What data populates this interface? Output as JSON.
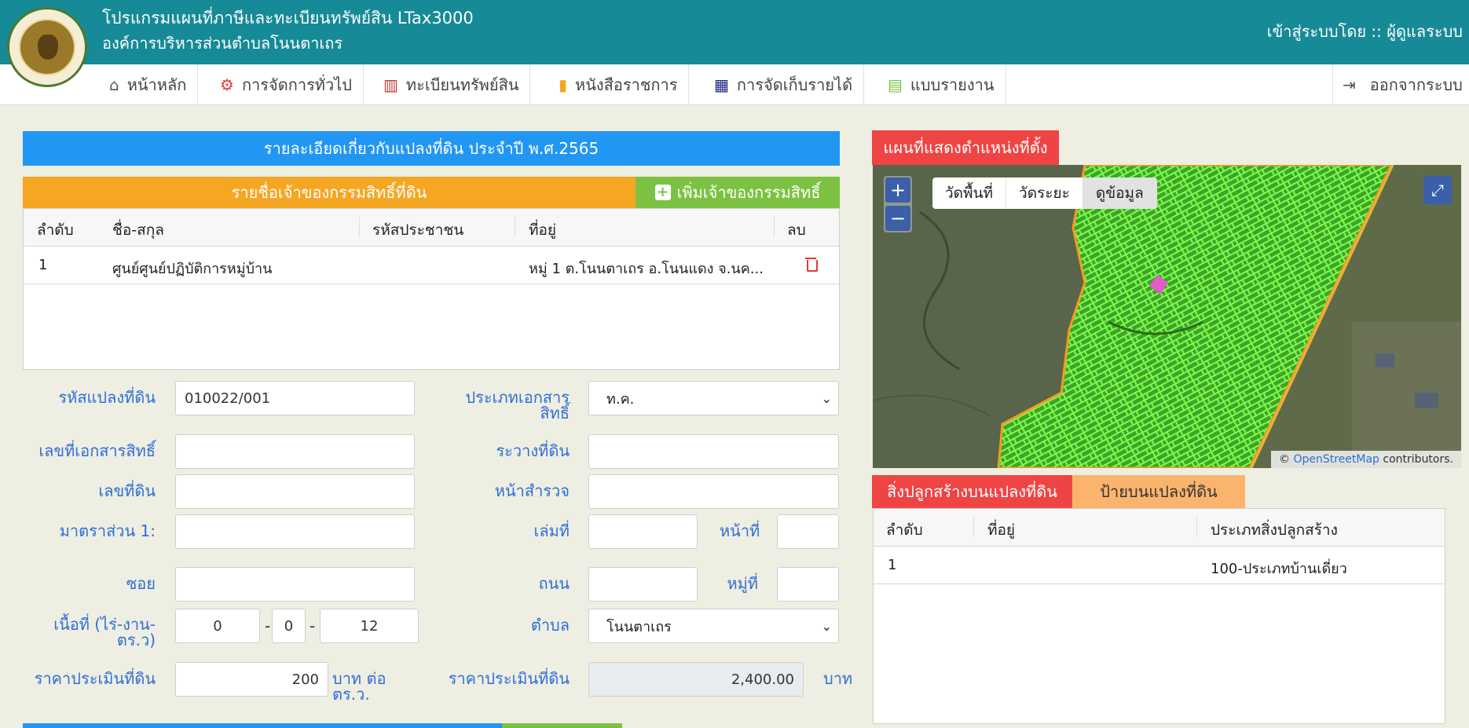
{
  "header": {
    "app_title": "โปรแกรมแผนที่ภาษีและทะเบียนทรัพย์สิน LTax3000",
    "org_title": "องค์การบริหารส่วนตำบลโนนตาเถร",
    "login_info": "เข้าสู่ระบบโดย :: ผู้ดูแลระบบ"
  },
  "nav": {
    "items": [
      {
        "label": "หน้าหลัก",
        "icon": "home-icon"
      },
      {
        "label": "การจัดการทั่วไป",
        "icon": "gears-icon"
      },
      {
        "label": "ทะเบียนทรัพย์สิน",
        "icon": "map-icon"
      },
      {
        "label": "หนังสือราชการ",
        "icon": "document-icon"
      },
      {
        "label": "การจัดเก็บรายได้",
        "icon": "calculator-icon"
      },
      {
        "label": "แบบรายงาน",
        "icon": "table-icon"
      }
    ],
    "logout": "ออกจากระบบ"
  },
  "land": {
    "title": "รายละเอียดเกี่ยวกับแปลงที่ดิน ประจำปี พ.ศ.2565",
    "owners_title": "รายชื่อเจ้าของกรรมสิทธิ์ที่ดิน",
    "add_owner": "เพิ่มเจ้าของกรรมสิทธิ์",
    "owner_columns": [
      "ลำดับ",
      "ชื่อ-สกุล",
      "รหัสประชาชน",
      "ที่อยู่",
      "ลบ"
    ],
    "owners": [
      {
        "no": "1",
        "name": "ศูนย์ศูนย์ปฏิบัติการหมู่บ้าน",
        "citizen_id": "",
        "address": "หมู่ 1 ต.โนนตาเถร อ.โนนแดง จ.นค..."
      }
    ]
  },
  "form": {
    "parcel_code_label": "รหัสแปลงที่ดิน",
    "parcel_code": "010022/001",
    "doc_type_label": "ประเภทเอกสารสิทธิ์",
    "doc_type": "ท.ค.",
    "doc_no_label": "เลขที่เอกสารสิทธิ์",
    "doc_no": "",
    "survey_label": "ระวางที่ดิน",
    "survey": "",
    "land_no_label": "เลขที่ดิน",
    "land_no": "",
    "survey_page_label": "หน้าสำรวจ",
    "survey_page": "",
    "scale_label": "มาตราส่วน 1:",
    "scale": "",
    "book_label": "เล่มที่",
    "book": "",
    "page_label": "หน้าที่",
    "page": "",
    "soi_label": "ซอย",
    "soi": "",
    "road_label": "ถนน",
    "road": "",
    "moo_label": "หมู่ที่",
    "moo": "",
    "area_label": "เนื้อที่ (ไร่-งาน-ตร.ว)",
    "area_rai": "0",
    "area_ngan": "0",
    "area_wa": "12",
    "dash": "-",
    "tambon_label": "ตำบล",
    "tambon": "โนนตาเถร",
    "price_label": "ราคาประเมินที่ดิน",
    "price_per_wa": "200",
    "price_unit": "บาท ต่อ ตร.ว.",
    "total_label": "ราคาประเมินที่ดิน",
    "total": "2,400.00",
    "total_unit": "บาท"
  },
  "map": {
    "tab": "แผนที่แสดงตำแหน่งที่ตั้ง",
    "zoom_in": "+",
    "zoom_out": "−",
    "tools": [
      "วัดพื้นที่",
      "วัดระยะ",
      "ดูข้อมูล"
    ],
    "attribution_prefix": "©",
    "attribution_link": "OpenStreetMap",
    "attribution_suffix": "contributors."
  },
  "buildings": {
    "tab": "สิ่งปลูกสร้างบนแปลงที่ดิน",
    "tab_signs": "ป้ายบนแปลงที่ดิน",
    "columns": [
      "ลำดับ",
      "ที่อยู่",
      "ประเภทสิ่งปลูกสร้าง"
    ],
    "rows": [
      {
        "no": "1",
        "address": "",
        "type": "100-ประเภทบ้านเดี่ยว"
      }
    ]
  }
}
